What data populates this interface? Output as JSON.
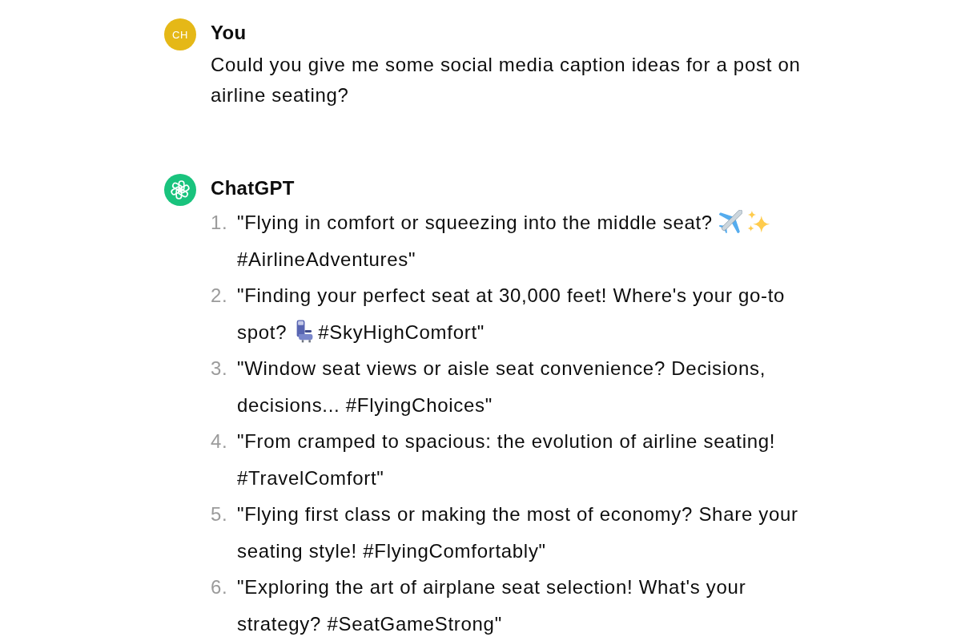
{
  "messages": [
    {
      "kind": "user",
      "color": "#e5b817",
      "initials": "CH",
      "author": "You",
      "text": "Could you give me some social media caption ideas for a post on airline seating?"
    },
    {
      "kind": "assistant",
      "color": "#19c37d",
      "author": "ChatGPT",
      "items": [
        {
          "number": "1.",
          "parts": [
            {
              "kind": "text",
              "text": "\"Flying in comfort or squeezing into the middle seat?"
            },
            {
              "kind": "airplane"
            },
            {
              "kind": "sparkles"
            },
            {
              "kind": "text",
              "text": "#AirlineAdventures\""
            }
          ]
        },
        {
          "number": "2.",
          "parts": [
            {
              "kind": "text",
              "text": "\"Finding your perfect seat at 30,000 feet! Where's your go-to spot?"
            },
            {
              "kind": "seat"
            },
            {
              "kind": "text",
              "text": "#SkyHighComfort\""
            }
          ]
        },
        {
          "number": "3.",
          "parts": [
            {
              "kind": "text",
              "text": "\"Window seat views or aisle seat convenience? Decisions, decisions... #FlyingChoices\""
            }
          ]
        },
        {
          "number": "4.",
          "parts": [
            {
              "kind": "text",
              "text": "\"From cramped to spacious: the evolution of airline seating! #TravelComfort\""
            }
          ]
        },
        {
          "number": "5.",
          "parts": [
            {
              "kind": "text",
              "text": "\"Flying first class or making the most of economy? Share your seating style! #FlyingComfortably\""
            }
          ]
        },
        {
          "number": "6.",
          "parts": [
            {
              "kind": "text",
              "text": "\"Exploring the art of airplane seat selection! What's your strategy? #SeatGameStrong\""
            }
          ]
        }
      ]
    }
  ]
}
